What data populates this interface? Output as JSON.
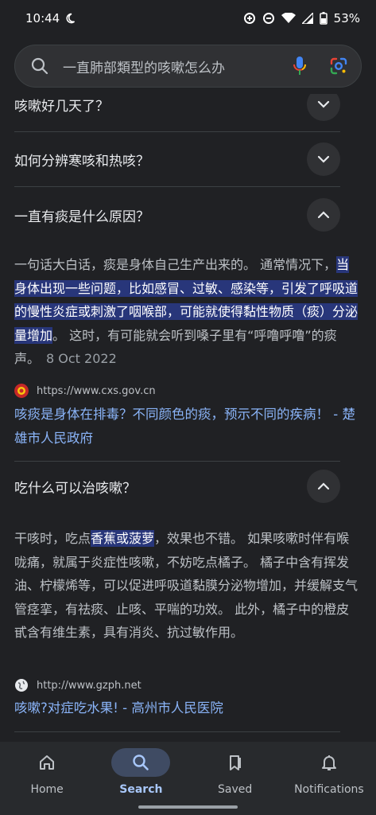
{
  "status": {
    "time": "10:44",
    "battery": "53%"
  },
  "search": {
    "query": "一直肺部類型的咳嗽怎么办"
  },
  "faq": [
    {
      "question": "咳嗽好几天了？",
      "expanded": false
    },
    {
      "question": "如何分辨寒咳和热咳？",
      "expanded": false
    },
    {
      "question": "一直有痰是什么原因？",
      "expanded": true
    },
    {
      "question": "吃什么可以治咳嗽？",
      "expanded": true
    }
  ],
  "answer1": {
    "pre": "一句话大白话，痰是身体自己生产出来的。 通常情况下，",
    "highlight": "当身体出现一些问题，比如感冒、过敏、感染等，引发了呼吸道的慢性炎症或刺激了咽喉部，可能就使得黏性物质（痰）分泌量增加",
    "post": "。 这时，有可能就会听到嗓子里有“呼噜呼噜”的痰声。",
    "date": "8 Oct 2022",
    "source_url": "https://www.cxs.gov.cn",
    "link_title": "咳痰是身体在排毒？不同颜色的痰，预示不同的疾病！ - 楚雄市人民政府"
  },
  "answer2": {
    "pre": "干咳时，吃点",
    "highlight": "香蕉或菠萝",
    "post": "，效果也不错。 如果咳嗽时伴有喉咙痛，就属于炎症性咳嗽，不妨吃点橘子。 橘子中含有挥发油、柠檬烯等，可以促进呼吸道黏膜分泌物增加，并缓解支气管痉挛，有祛痰、止咳、平喘的功效。 此外，橘子中的橙皮甙含有维生素，具有消炎、抗过敏作用。",
    "source_url": "http://www.gzph.net",
    "link_title": "咳嗽?对症吃水果! - 高州市人民医院"
  },
  "nav": [
    {
      "label": "Home",
      "icon": "home-icon",
      "active": false
    },
    {
      "label": "Search",
      "icon": "search-icon",
      "active": true
    },
    {
      "label": "Saved",
      "icon": "bookmark-icon",
      "active": false
    },
    {
      "label": "Notifications",
      "icon": "bell-icon",
      "active": false
    }
  ]
}
